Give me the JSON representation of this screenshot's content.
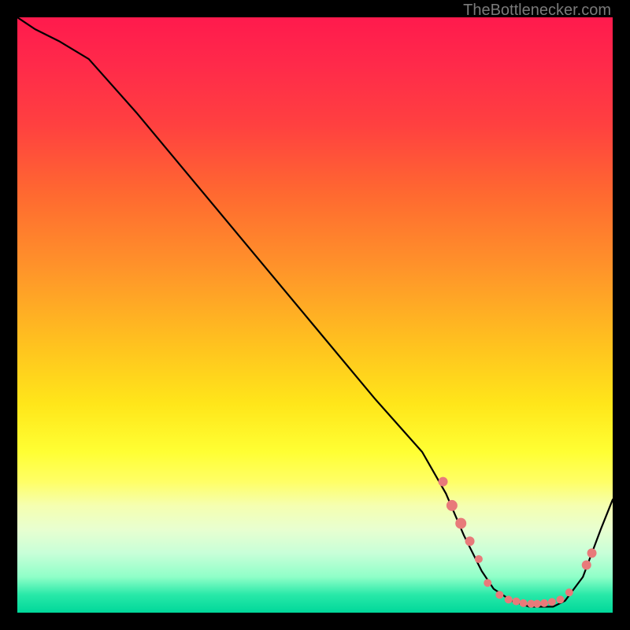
{
  "attribution": "TheBottlenecker.com",
  "chart_data": {
    "type": "line",
    "title": "",
    "xlabel": "",
    "ylabel": "",
    "xlim": [
      0,
      100
    ],
    "ylim": [
      0,
      100
    ],
    "series": [
      {
        "name": "curve",
        "x": [
          0,
          3,
          7,
          12,
          20,
          30,
          40,
          50,
          60,
          68,
          72,
          75,
          78,
          80,
          83,
          86,
          88,
          90,
          92,
          95,
          98,
          100
        ],
        "y": [
          100,
          98,
          96,
          93,
          84,
          72,
          60,
          48,
          36,
          27,
          20,
          13,
          7,
          4,
          2,
          1,
          1,
          1,
          2,
          6,
          14,
          19
        ]
      }
    ],
    "markers": {
      "name": "marker-cluster",
      "style": "dot",
      "color": "#e87a7a",
      "points": [
        {
          "x": 71.5,
          "y": 22.0,
          "r": 6
        },
        {
          "x": 73.0,
          "y": 18.0,
          "r": 7
        },
        {
          "x": 74.5,
          "y": 15.0,
          "r": 7
        },
        {
          "x": 76.0,
          "y": 12.0,
          "r": 6
        },
        {
          "x": 77.5,
          "y": 9.0,
          "r": 5
        },
        {
          "x": 79.0,
          "y": 5.0,
          "r": 5
        },
        {
          "x": 81.0,
          "y": 3.0,
          "r": 5
        },
        {
          "x": 82.5,
          "y": 2.2,
          "r": 5
        },
        {
          "x": 83.8,
          "y": 1.9,
          "r": 5
        },
        {
          "x": 85.0,
          "y": 1.6,
          "r": 5
        },
        {
          "x": 86.3,
          "y": 1.5,
          "r": 5
        },
        {
          "x": 87.3,
          "y": 1.5,
          "r": 5
        },
        {
          "x": 88.5,
          "y": 1.6,
          "r": 5
        },
        {
          "x": 89.8,
          "y": 1.8,
          "r": 5
        },
        {
          "x": 91.2,
          "y": 2.2,
          "r": 5
        },
        {
          "x": 92.7,
          "y": 3.4,
          "r": 5
        },
        {
          "x": 95.6,
          "y": 8.0,
          "r": 6
        },
        {
          "x": 96.5,
          "y": 10.0,
          "r": 6
        }
      ]
    }
  }
}
